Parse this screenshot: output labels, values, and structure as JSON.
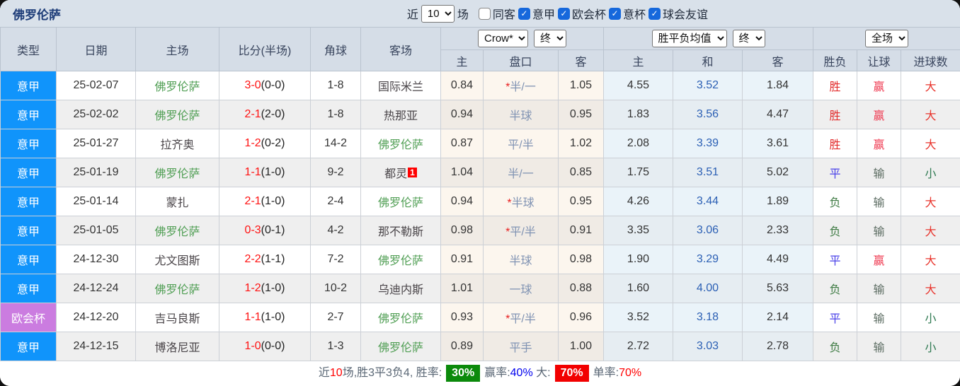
{
  "header": {
    "team_title": "佛罗伦萨",
    "recent_label": "近",
    "recent_value": "10",
    "matches_label": "场",
    "filters": [
      {
        "label": "同客",
        "checked": false
      },
      {
        "label": "意甲",
        "checked": true
      },
      {
        "label": "欧会杯",
        "checked": true
      },
      {
        "label": "意杯",
        "checked": true
      },
      {
        "label": "球会友谊",
        "checked": true
      }
    ]
  },
  "selectors": {
    "bookmaker": "Crow*",
    "bookmaker_time": "终",
    "europe": "胜平负均值",
    "europe_time": "终",
    "scope": "全场"
  },
  "columns": {
    "type": "类型",
    "date": "日期",
    "home": "主场",
    "score": "比分(半场)",
    "corners": "角球",
    "away": "客场",
    "asian": [
      "主",
      "盘口",
      "客"
    ],
    "europe": [
      "主",
      "和",
      "客"
    ],
    "results": [
      "胜负",
      "让球",
      "进球数"
    ]
  },
  "colors": {
    "league_serie_a": "#1094fb",
    "league_conference": "#cb7ce0",
    "team_green": "#4f9e53",
    "score_red": "#ff1111",
    "win_red": "#e22b2b",
    "draw_blue": "#4940e8",
    "lose_green": "#3d7a42"
  },
  "rows": [
    {
      "league": "意甲",
      "league_color": "blue",
      "date": "25-02-07",
      "home": "佛罗伦萨",
      "home_team": true,
      "score": "3-0",
      "half": "(0-0)",
      "corners": "1-8",
      "away": "国际米兰",
      "away_team": false,
      "away_badge": "",
      "ah_home": "0.84",
      "ah_star": true,
      "ah_line": "半/一",
      "ah_away": "1.05",
      "eu_home": "4.55",
      "eu_draw": "3.52",
      "eu_away": "1.84",
      "result": "胜",
      "result_type": "win",
      "handicap": "赢",
      "handicap_type": "win",
      "goals": "大",
      "goals_type": "over"
    },
    {
      "league": "意甲",
      "league_color": "blue",
      "date": "25-02-02",
      "home": "佛罗伦萨",
      "home_team": true,
      "score": "2-1",
      "half": "(2-0)",
      "corners": "1-8",
      "away": "热那亚",
      "away_team": false,
      "away_badge": "",
      "ah_home": "0.94",
      "ah_star": false,
      "ah_line": "半球",
      "ah_away": "0.95",
      "eu_home": "1.83",
      "eu_draw": "3.56",
      "eu_away": "4.47",
      "result": "胜",
      "result_type": "win",
      "handicap": "赢",
      "handicap_type": "win",
      "goals": "大",
      "goals_type": "over"
    },
    {
      "league": "意甲",
      "league_color": "blue",
      "date": "25-01-27",
      "home": "拉齐奥",
      "home_team": false,
      "score": "1-2",
      "half": "(0-2)",
      "corners": "14-2",
      "away": "佛罗伦萨",
      "away_team": true,
      "away_badge": "",
      "ah_home": "0.87",
      "ah_star": false,
      "ah_line": "平/半",
      "ah_away": "1.02",
      "eu_home": "2.08",
      "eu_draw": "3.39",
      "eu_away": "3.61",
      "result": "胜",
      "result_type": "win",
      "handicap": "赢",
      "handicap_type": "win",
      "goals": "大",
      "goals_type": "over"
    },
    {
      "league": "意甲",
      "league_color": "blue",
      "date": "25-01-19",
      "home": "佛罗伦萨",
      "home_team": true,
      "score": "1-1",
      "half": "(1-0)",
      "corners": "9-2",
      "away": "都灵",
      "away_team": false,
      "away_badge": "1",
      "ah_home": "1.04",
      "ah_star": false,
      "ah_line": "半/一",
      "ah_away": "0.85",
      "eu_home": "1.75",
      "eu_draw": "3.51",
      "eu_away": "5.02",
      "result": "平",
      "result_type": "draw",
      "handicap": "输",
      "handicap_type": "lose",
      "goals": "小",
      "goals_type": "under"
    },
    {
      "league": "意甲",
      "league_color": "blue",
      "date": "25-01-14",
      "home": "蒙扎",
      "home_team": false,
      "score": "2-1",
      "half": "(1-0)",
      "corners": "2-4",
      "away": "佛罗伦萨",
      "away_team": true,
      "away_badge": "",
      "ah_home": "0.94",
      "ah_star": true,
      "ah_line": "半球",
      "ah_away": "0.95",
      "eu_home": "4.26",
      "eu_draw": "3.44",
      "eu_away": "1.89",
      "result": "负",
      "result_type": "lose",
      "handicap": "输",
      "handicap_type": "lose",
      "goals": "大",
      "goals_type": "over"
    },
    {
      "league": "意甲",
      "league_color": "blue",
      "date": "25-01-05",
      "home": "佛罗伦萨",
      "home_team": true,
      "score": "0-3",
      "half": "(0-1)",
      "corners": "4-2",
      "away": "那不勒斯",
      "away_team": false,
      "away_badge": "",
      "ah_home": "0.98",
      "ah_star": true,
      "ah_line": "平/半",
      "ah_away": "0.91",
      "eu_home": "3.35",
      "eu_draw": "3.06",
      "eu_away": "2.33",
      "result": "负",
      "result_type": "lose",
      "handicap": "输",
      "handicap_type": "lose",
      "goals": "大",
      "goals_type": "over"
    },
    {
      "league": "意甲",
      "league_color": "blue",
      "date": "24-12-30",
      "home": "尤文图斯",
      "home_team": false,
      "score": "2-2",
      "half": "(1-1)",
      "corners": "7-2",
      "away": "佛罗伦萨",
      "away_team": true,
      "away_badge": "",
      "ah_home": "0.91",
      "ah_star": false,
      "ah_line": "半球",
      "ah_away": "0.98",
      "eu_home": "1.90",
      "eu_draw": "3.29",
      "eu_away": "4.49",
      "result": "平",
      "result_type": "draw",
      "handicap": "赢",
      "handicap_type": "win",
      "goals": "大",
      "goals_type": "over"
    },
    {
      "league": "意甲",
      "league_color": "blue",
      "date": "24-12-24",
      "home": "佛罗伦萨",
      "home_team": true,
      "score": "1-2",
      "half": "(1-0)",
      "corners": "10-2",
      "away": "乌迪内斯",
      "away_team": false,
      "away_badge": "",
      "ah_home": "1.01",
      "ah_star": false,
      "ah_line": "一球",
      "ah_away": "0.88",
      "eu_home": "1.60",
      "eu_draw": "4.00",
      "eu_away": "5.63",
      "result": "负",
      "result_type": "lose",
      "handicap": "输",
      "handicap_type": "lose",
      "goals": "大",
      "goals_type": "over"
    },
    {
      "league": "欧会杯",
      "league_color": "purple",
      "date": "24-12-20",
      "home": "吉马良斯",
      "home_team": false,
      "score": "1-1",
      "half": "(1-0)",
      "corners": "2-7",
      "away": "佛罗伦萨",
      "away_team": true,
      "away_badge": "",
      "ah_home": "0.93",
      "ah_star": true,
      "ah_line": "平/半",
      "ah_away": "0.96",
      "eu_home": "3.52",
      "eu_draw": "3.18",
      "eu_away": "2.14",
      "result": "平",
      "result_type": "draw",
      "handicap": "输",
      "handicap_type": "lose",
      "goals": "小",
      "goals_type": "under"
    },
    {
      "league": "意甲",
      "league_color": "blue",
      "date": "24-12-15",
      "home": "博洛尼亚",
      "home_team": false,
      "score": "1-0",
      "half": "(0-0)",
      "corners": "1-3",
      "away": "佛罗伦萨",
      "away_team": true,
      "away_badge": "",
      "ah_home": "0.89",
      "ah_star": false,
      "ah_line": "平手",
      "ah_away": "1.00",
      "eu_home": "2.72",
      "eu_draw": "3.03",
      "eu_away": "2.78",
      "result": "负",
      "result_type": "lose",
      "handicap": "输",
      "handicap_type": "lose",
      "goals": "小",
      "goals_type": "under"
    }
  ],
  "summary": {
    "near_label": "近",
    "count": "10",
    "record": "场,胜3平3负4, 胜率:",
    "win_pct": "30%",
    "odds_label": "赢率:",
    "odds_pct": "40%",
    "big_label": " 大:",
    "big_pct": "70%",
    "single_label": "单率:",
    "single_pct": "70%"
  }
}
